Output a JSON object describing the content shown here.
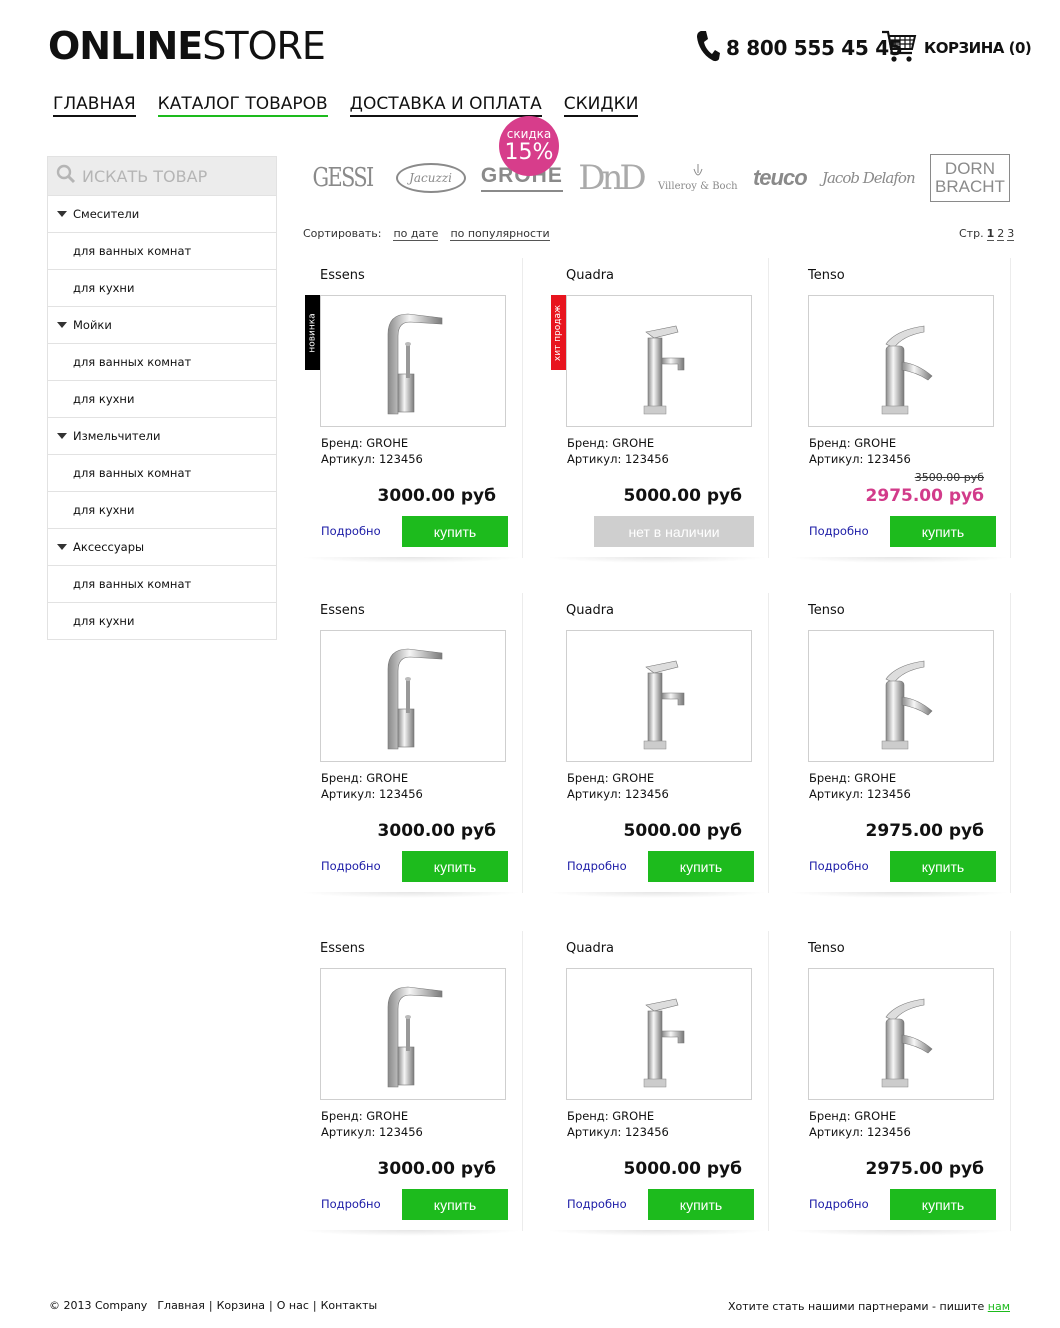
{
  "header": {
    "logo_bold": "ONLINE",
    "logo_regular": "STORE",
    "phone": "8 800 555 45 45",
    "cart_label": "КОРЗИНА (0)"
  },
  "nav": {
    "items": [
      {
        "label": "ГЛАВНАЯ",
        "active": false
      },
      {
        "label": "КАТАЛОГ ТОВАРОВ",
        "active": true
      },
      {
        "label": "ДОСТАВКА И ОПЛАТА",
        "active": false
      },
      {
        "label": "СКИДКИ",
        "active": false
      }
    ]
  },
  "sidebar": {
    "search_placeholder": "ИСКАТЬ ТОВАР",
    "categories": [
      {
        "label": "Смесители",
        "children": [
          "для ванных комнат",
          "для кухни"
        ]
      },
      {
        "label": "Мойки",
        "children": [
          "для ванных комнат",
          "для кухни"
        ]
      },
      {
        "label": "Измельчители",
        "children": [
          "для ванных комнат",
          "для кухни"
        ]
      },
      {
        "label": "Аксессуары",
        "children": [
          "для ванных комнат",
          "для кухни"
        ]
      }
    ]
  },
  "brands": [
    "GESSI",
    "Jacuzzi",
    "GROHE",
    "DnD",
    "Villeroy & Boch",
    "teuco",
    "Jacob Delafon",
    "DORN BRACHT"
  ],
  "sort": {
    "label": "Сортировать:",
    "by_date": "по дате",
    "by_popularity": "по популярности"
  },
  "pagination": {
    "label": "Стр.",
    "pages": [
      "1",
      "2",
      "3"
    ],
    "current": "1"
  },
  "products": [
    {
      "name": "Essens",
      "brand": "Бренд:  GROHE",
      "article": "Артикул: 123456",
      "price": "3000.00 руб",
      "old_price": "",
      "badge": "новинка",
      "discount": "",
      "more": "Подробно",
      "buy": "купить",
      "available": true
    },
    {
      "name": "Quadra",
      "brand": "Бренд:  GROHE",
      "article": "Артикул: 123456",
      "price": "5000.00 руб",
      "old_price": "",
      "badge": "хит продаж",
      "discount": "",
      "more": "Подробно",
      "buy": "нет в наличии",
      "available": false
    },
    {
      "name": "Tenso",
      "brand": "Бренд:  GROHE",
      "article": "Артикул: 123456",
      "price": "2975.00 руб",
      "old_price": "3500.00 руб",
      "badge": "",
      "discount_label": "скидка",
      "discount": "15%",
      "more": "Подробно",
      "buy": "купить",
      "available": true
    },
    {
      "name": "Essens",
      "brand": "Бренд:  GROHE",
      "article": "Артикул: 123456",
      "price": "3000.00 руб",
      "old_price": "",
      "badge": "",
      "discount": "",
      "more": "Подробно",
      "buy": "купить",
      "available": true
    },
    {
      "name": "Quadra",
      "brand": "Бренд:  GROHE",
      "article": "Артикул: 123456",
      "price": "5000.00 руб",
      "old_price": "",
      "badge": "",
      "discount": "",
      "more": "Подробно",
      "buy": "купить",
      "available": true
    },
    {
      "name": "Tenso",
      "brand": "Бренд:  GROHE",
      "article": "Артикул: 123456",
      "price": "2975.00 руб",
      "old_price": "",
      "badge": "",
      "discount": "",
      "more": "Подробно",
      "buy": "купить",
      "available": true
    },
    {
      "name": "Essens",
      "brand": "Бренд:  GROHE",
      "article": "Артикул: 123456",
      "price": "3000.00 руб",
      "old_price": "",
      "badge": "",
      "discount": "",
      "more": "Подробно",
      "buy": "купить",
      "available": true
    },
    {
      "name": "Quadra",
      "brand": "Бренд:  GROHE",
      "article": "Артикул: 123456",
      "price": "5000.00 руб",
      "old_price": "",
      "badge": "",
      "discount": "",
      "more": "Подробно",
      "buy": "купить",
      "available": true
    },
    {
      "name": "Tenso",
      "brand": "Бренд:  GROHE",
      "article": "Артикул: 123456",
      "price": "2975.00 руб",
      "old_price": "",
      "badge": "",
      "discount": "",
      "more": "Подробно",
      "buy": "купить",
      "available": true
    }
  ],
  "footer": {
    "copyright": "© 2013 Company",
    "links": [
      "Главная",
      "Корзина",
      "О нас",
      "Контакты"
    ],
    "partner_text": "Хотите стать нашими партнерами - пишите",
    "partner_link": "нам"
  },
  "colors": {
    "accent_green": "#1dbb1d",
    "sale_pink": "#d23b8a",
    "badge_new": "#000000",
    "badge_hit": "#e8141e",
    "link_blue": "#1a1aa6"
  }
}
